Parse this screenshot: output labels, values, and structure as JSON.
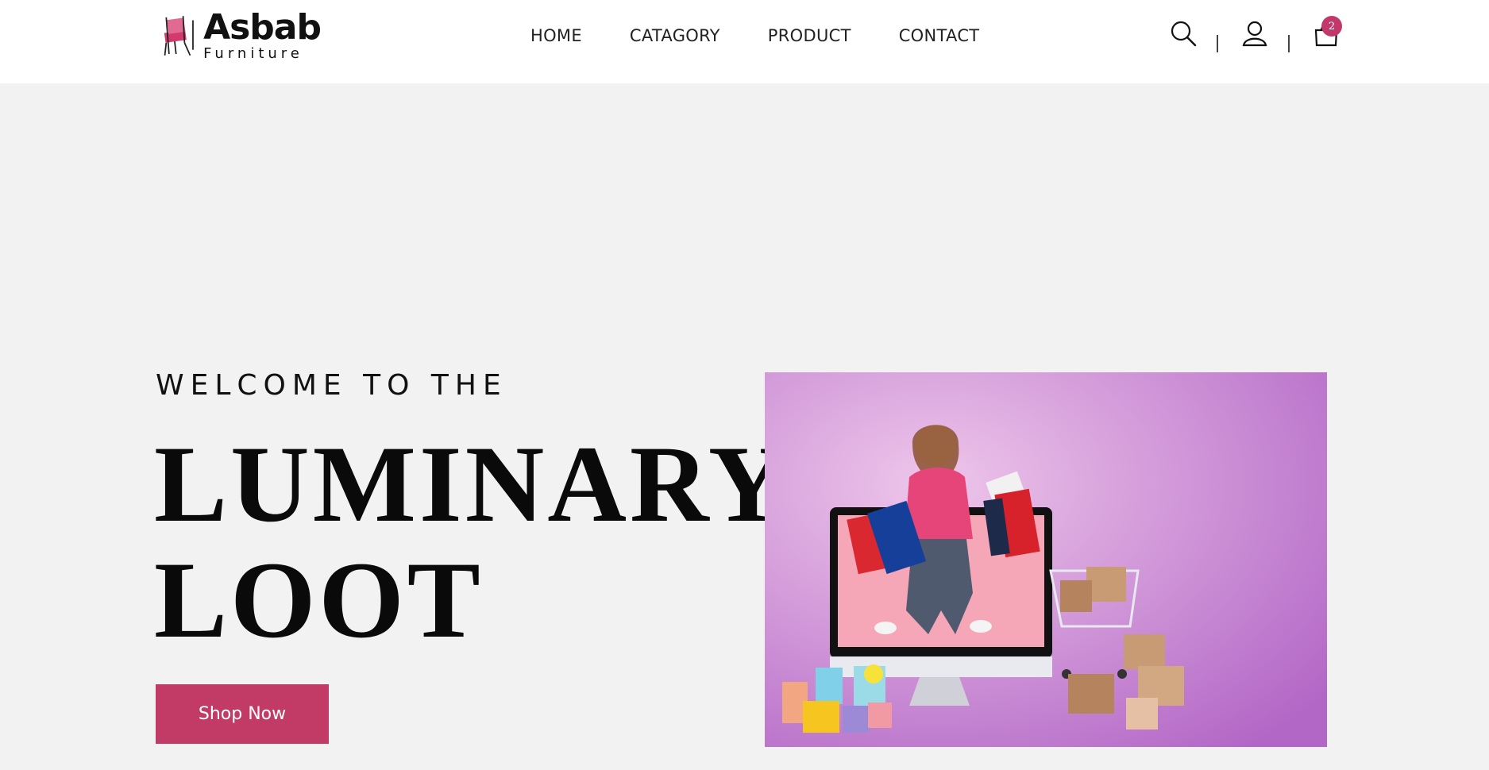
{
  "brand": {
    "name": "Asbab",
    "tagline": "Furniture",
    "accent": "#c13b66"
  },
  "nav": {
    "items": [
      {
        "label": "HOME"
      },
      {
        "label": "CATAGORY"
      },
      {
        "label": "PRODUCT"
      },
      {
        "label": "CONTACT"
      }
    ]
  },
  "header_icons": {
    "search": "search-icon",
    "account": "user-icon",
    "cart": "shopping-bag-icon",
    "cart_count": "2"
  },
  "hero": {
    "eyebrow": "WELCOME TO THE",
    "headline_line1": "LUMINARY-",
    "headline_line2": "LOOT",
    "cta_label": "Shop Now",
    "background": "#f2f2f2",
    "image_gradient_from": "#ecc4e8",
    "image_gradient_to": "#b36ac8"
  }
}
